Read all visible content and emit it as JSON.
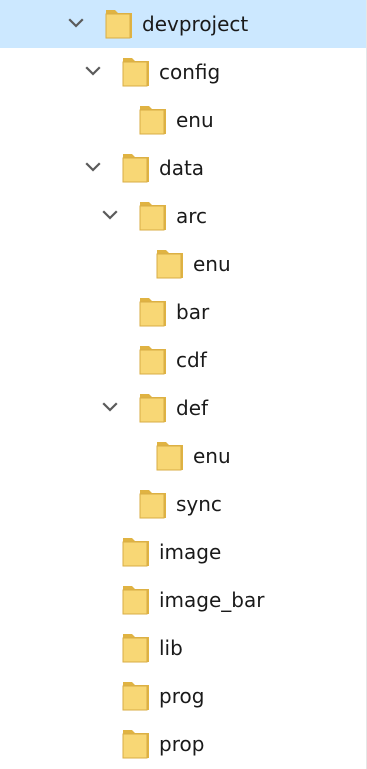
{
  "tree": {
    "items": [
      {
        "label": "devproject",
        "depth": 0,
        "expanded": true,
        "selected": true
      },
      {
        "label": "config",
        "depth": 1,
        "expanded": true
      },
      {
        "label": "enu",
        "depth": 2,
        "expanded": null
      },
      {
        "label": "data",
        "depth": 1,
        "expanded": true
      },
      {
        "label": "arc",
        "depth": 2,
        "expanded": true
      },
      {
        "label": "enu",
        "depth": 3,
        "expanded": null
      },
      {
        "label": "bar",
        "depth": 2,
        "expanded": null
      },
      {
        "label": "cdf",
        "depth": 2,
        "expanded": null
      },
      {
        "label": "def",
        "depth": 2,
        "expanded": true
      },
      {
        "label": "enu",
        "depth": 3,
        "expanded": null
      },
      {
        "label": "sync",
        "depth": 2,
        "expanded": null
      },
      {
        "label": "image",
        "depth": 1,
        "expanded": null
      },
      {
        "label": "image_bar",
        "depth": 1,
        "expanded": null
      },
      {
        "label": "lib",
        "depth": 1,
        "expanded": null
      },
      {
        "label": "prog",
        "depth": 1,
        "expanded": null
      },
      {
        "label": "prop",
        "depth": 1,
        "expanded": null
      }
    ]
  },
  "icons": {
    "folder": "folder-icon",
    "expanded": "chevron-down-icon"
  },
  "colors": {
    "selection": "#cce8ff",
    "folder_front": "#f8d775",
    "folder_back": "#e0b342",
    "chevron": "#5a5a5a"
  }
}
